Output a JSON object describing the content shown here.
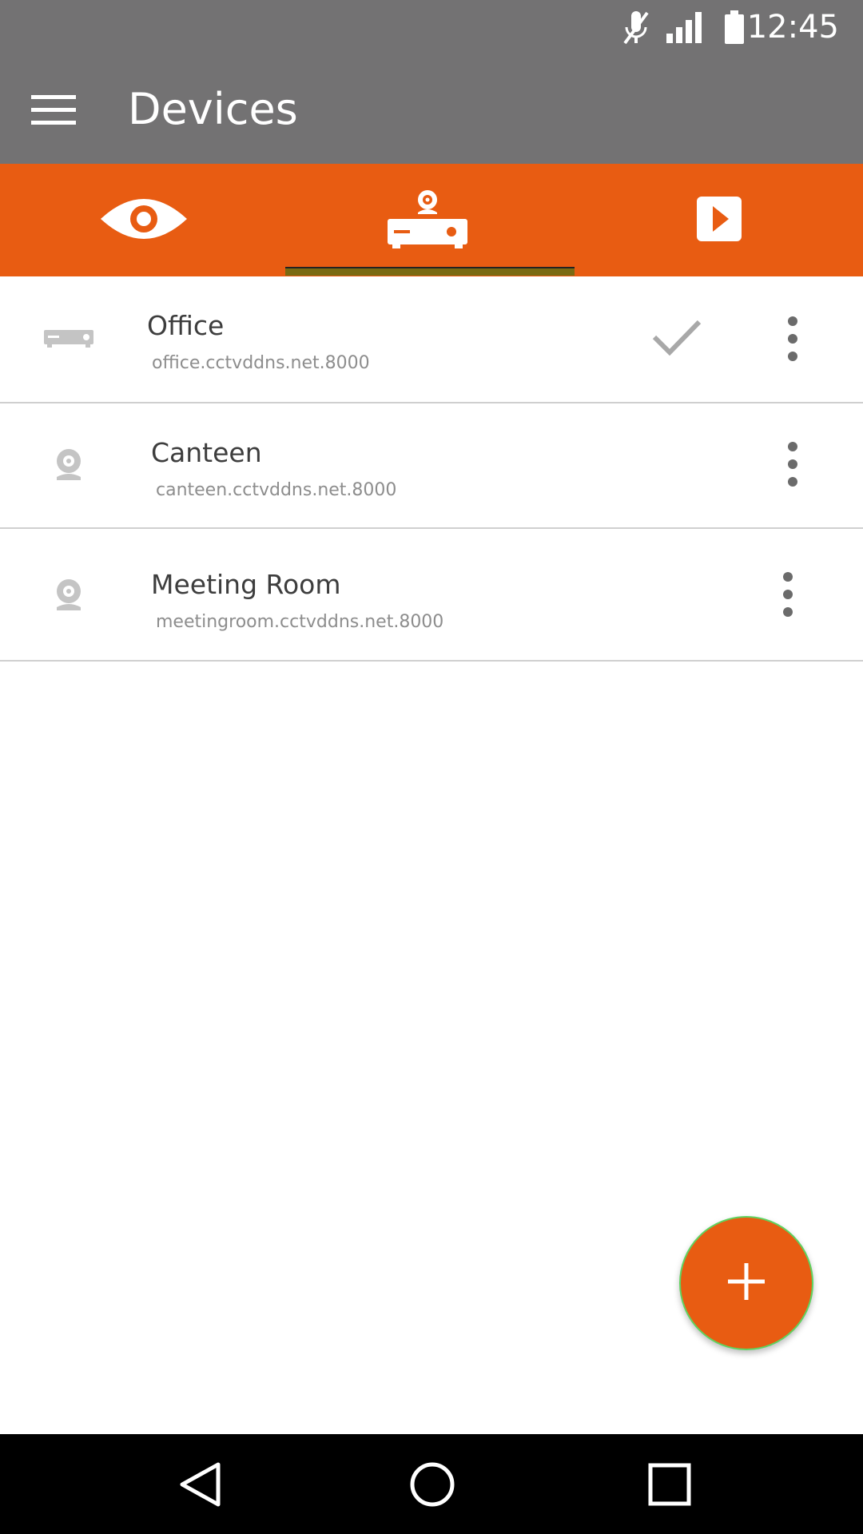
{
  "status_bar": {
    "time": "12:45",
    "icons": [
      "mute-icon",
      "signal-icon",
      "battery-icon"
    ]
  },
  "app_bar": {
    "title": "Devices",
    "menu_icon": "hamburger-menu-icon"
  },
  "tabs": [
    {
      "icon": "eye-icon",
      "selected": false
    },
    {
      "icon": "dvr-camera-icon",
      "selected": true
    },
    {
      "icon": "play-icon",
      "selected": false
    }
  ],
  "devices": [
    {
      "name": "Office",
      "address": "office.cctvddns.net.8000",
      "icon": "dvr-icon",
      "selected": true
    },
    {
      "name": "Canteen",
      "address": "canteen.cctvddns.net.8000",
      "icon": "webcam-icon",
      "selected": false
    },
    {
      "name": "Meeting Room",
      "address": "meetingroom.cctvddns.net.8000",
      "icon": "webcam-icon",
      "selected": false
    }
  ],
  "fab": {
    "icon": "plus-icon"
  },
  "nav_bar": {
    "icons": [
      "back-icon",
      "home-icon",
      "recents-icon"
    ]
  },
  "colors": {
    "accent": "#e85c12",
    "bar_gray": "#737273",
    "text_dark": "#3d3d3d",
    "text_secondary": "#8d8d8d",
    "divider": "#cfcfcf"
  }
}
